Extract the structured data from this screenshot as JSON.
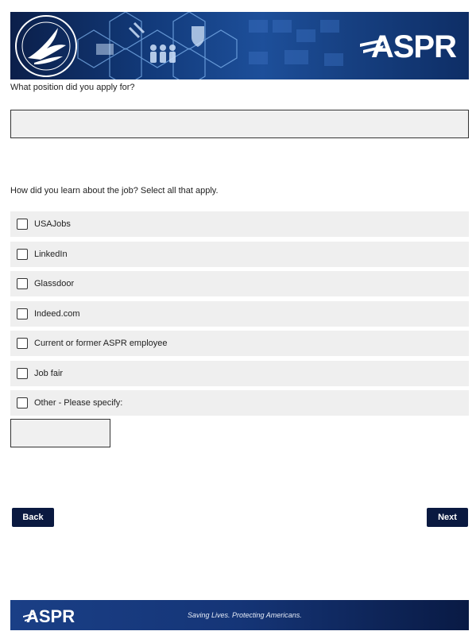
{
  "header": {
    "brand": "ASPR",
    "seal_icon": "hhs-eagle-seal-icon",
    "colors": {
      "banner": "#123a7a",
      "dark": "#0a1940"
    }
  },
  "form": {
    "position_question": "What position did you apply for?",
    "position_value": "",
    "source_question": "How did you learn about the job? Select all that apply.",
    "options": [
      {
        "label": "USAJobs",
        "checked": false
      },
      {
        "label": "LinkedIn",
        "checked": false
      },
      {
        "label": "Glassdoor",
        "checked": false
      },
      {
        "label": "Indeed.com",
        "checked": false
      },
      {
        "label": "Current or former ASPR employee",
        "checked": false
      },
      {
        "label": "Job fair",
        "checked": false
      },
      {
        "label": "Other - Please specify:",
        "checked": false
      }
    ],
    "other_value": ""
  },
  "nav": {
    "back_label": "Back",
    "next_label": "Next"
  },
  "footer": {
    "brand": "ASPR",
    "tagline": "Saving Lives. Protecting Americans."
  }
}
